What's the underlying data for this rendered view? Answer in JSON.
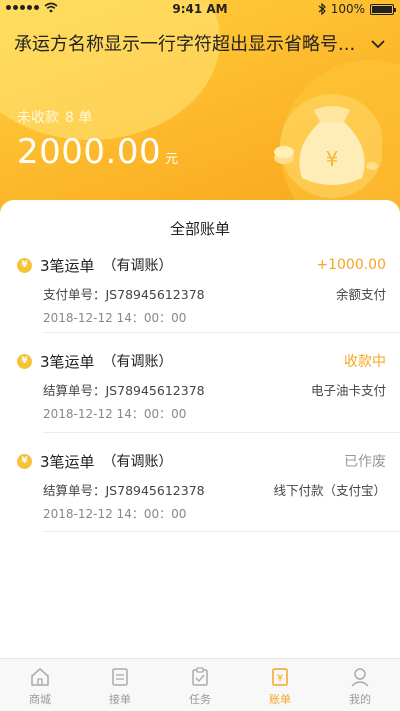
{
  "status_bar": {
    "time": "9:41 AM",
    "battery": "100%"
  },
  "header": {
    "carrier_name": "承运方名称显示一行字符超出显示省略号...",
    "unpaid_label": "未收款",
    "unpaid_count": "8 单",
    "amount": "2000.00",
    "amount_unit": "元"
  },
  "bills": {
    "title": "全部账单",
    "items": [
      {
        "title": "3笔运单",
        "tag": "（有调账）",
        "status": "+1000.00",
        "status_color": "#f5a623",
        "no_label": "支付单号：JS78945612378",
        "method": "余额支付",
        "time": "2018-12-12  14：00：00"
      },
      {
        "title": "3笔运单",
        "tag": "（有调账）",
        "status": "收款中",
        "status_color": "#f5a623",
        "no_label": "结算单号：JS78945612378",
        "method": "电子油卡支付",
        "time": "2018-12-12  14：00：00"
      },
      {
        "title": "3笔运单",
        "tag": "（有调账）",
        "status": "已作废",
        "status_color": "#999999",
        "no_label": "结算单号：JS78945612378",
        "method": "线下付款（支付宝）",
        "time": "2018-12-12  14：00：00"
      }
    ]
  },
  "tabbar": {
    "active_color": "#f5a623",
    "tabs": [
      {
        "label": "商城",
        "icon": "home-icon"
      },
      {
        "label": "接单",
        "icon": "clipboard-icon"
      },
      {
        "label": "任务",
        "icon": "task-icon"
      },
      {
        "label": "账单",
        "icon": "bill-icon"
      },
      {
        "label": "我的",
        "icon": "profile-icon"
      }
    ]
  }
}
